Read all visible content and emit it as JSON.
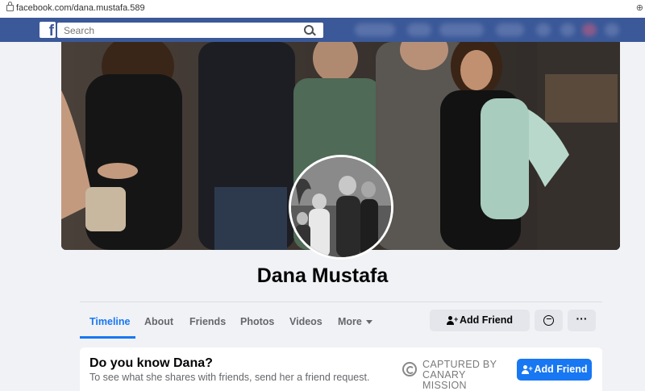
{
  "browser": {
    "url": "facebook.com/dana.mustafa.589"
  },
  "navbar": {
    "search_placeholder": "Search",
    "brand_color": "#3b5998"
  },
  "profile": {
    "name": "Dana Mustafa"
  },
  "tabs": [
    {
      "label": "Timeline",
      "active": true
    },
    {
      "label": "About"
    },
    {
      "label": "Friends"
    },
    {
      "label": "Photos"
    },
    {
      "label": "Videos"
    },
    {
      "label": "More"
    }
  ],
  "actions": {
    "add_friend_label": "Add Friend",
    "more_label": "···"
  },
  "prompt_card": {
    "question": "Do you know Dana?",
    "subtitle": "To see what she shares with friends, send her a friend request.",
    "add_friend_label": "Add Friend",
    "accent_color": "#1877f2"
  },
  "watermark": {
    "line1": "CAPTURED BY",
    "line2": "CANARY MISSION"
  },
  "icons": [
    "lock-icon",
    "facebook-logo-icon",
    "search-icon",
    "add-friend-icon",
    "messenger-icon",
    "more-icon",
    "chevron-down-icon"
  ]
}
